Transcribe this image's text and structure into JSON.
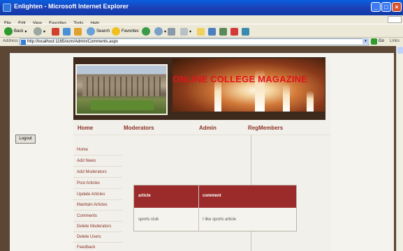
{
  "window": {
    "title": "Enlighten - Microsoft Internet Explorer"
  },
  "menu": [
    "File",
    "Edit",
    "View",
    "Favorites",
    "Tools",
    "Help"
  ],
  "toolbar": {
    "back": "Back",
    "search": "Search",
    "favorites": "Favorites"
  },
  "address": {
    "label": "Address",
    "url": "http://localhost:1165/ocm/Admin/Comments.aspx",
    "go": "Go",
    "links": "Links"
  },
  "site": {
    "banner_title": "ONLINE COLLEGE MAGAZINE",
    "nav": [
      "Home",
      "Moderators",
      "Admin",
      "RegMembers"
    ],
    "sidebar": [
      "Home",
      "Add News",
      "Add Moderators",
      "Post Articles",
      "Update Articles",
      "Maintain Articles",
      "Comments",
      "Delete Moderators",
      "Delete Users",
      "Feedback"
    ],
    "logout": "Logout"
  },
  "comments": {
    "columns": [
      "article",
      "comment"
    ],
    "rows": [
      [
        "sports club",
        "I like sports article"
      ]
    ]
  },
  "colors": {
    "accent": "#9b2b2b",
    "link": "#8a3228",
    "title_red": "#e0141c"
  }
}
